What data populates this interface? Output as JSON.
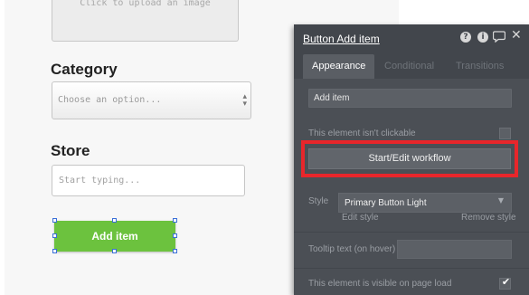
{
  "canvas": {
    "upload_placeholder": "Click to upload an image",
    "category_label": "Category",
    "category_dropdown_placeholder": "Choose an option...",
    "store_label": "Store",
    "store_input_placeholder": "Start typing...",
    "add_button_label": "Add item"
  },
  "panel": {
    "title": "Button Add item",
    "header_icons": [
      "help-icon",
      "info-icon",
      "comment-icon",
      "close-icon"
    ],
    "tabs": [
      {
        "label": "Appearance",
        "active": true
      },
      {
        "label": "Conditional",
        "active": false
      },
      {
        "label": "Transitions",
        "active": false
      }
    ],
    "text_field_value": "Add item",
    "not_clickable_label": "This element isn't clickable",
    "workflow_button_label": "Start/Edit workflow",
    "style_label": "Style",
    "style_value": "Primary Button Light",
    "edit_style_link": "Edit style",
    "remove_style_link": "Remove style",
    "tooltip_label": "Tooltip text (on hover)",
    "visible_on_load_label": "This element is visible on page load",
    "visible_on_load_checked": true
  },
  "colors": {
    "primary_button": "#6cc23e",
    "panel_bg": "#4b4f55",
    "highlight": "#e8262b",
    "selection_handle": "#3a6fd8"
  }
}
